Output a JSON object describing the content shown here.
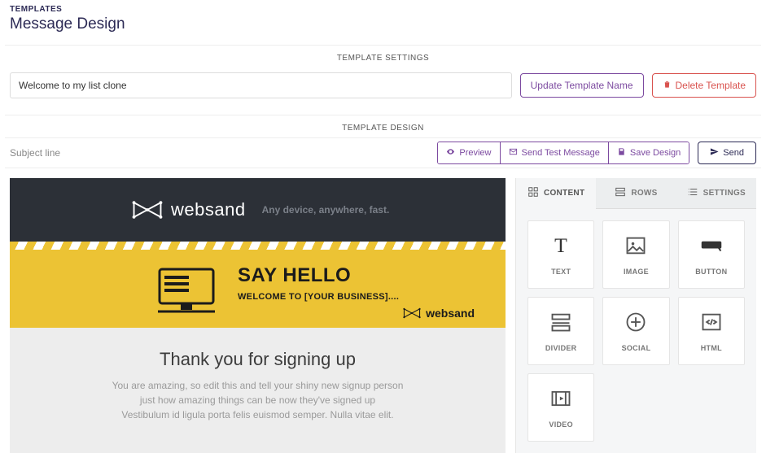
{
  "header": {
    "breadcrumb": "TEMPLATES",
    "title": "Message Design"
  },
  "sections": {
    "settings_label": "TEMPLATE SETTINGS",
    "design_label": "TEMPLATE DESIGN"
  },
  "template": {
    "name_value": "Welcome to my list clone",
    "update_btn": "Update Template Name",
    "delete_btn": "Delete Template"
  },
  "subject": {
    "placeholder": "Subject line",
    "value": ""
  },
  "actions": {
    "preview": "Preview",
    "send_test": "Send Test Message",
    "save_design": "Save Design",
    "send": "Send"
  },
  "email_preview": {
    "brand": "websand",
    "hero_tagline": "Any device, anywhere, fast.",
    "headline": "SAY HELLO",
    "subheadline": "WELCOME TO [YOUR BUSINESS]....",
    "footer_brand": "websand",
    "thanks_title": "Thank you for signing up",
    "thanks_body_1": "You are amazing, so edit this and tell your shiny new signup person",
    "thanks_body_2": "just how amazing things can be now they've signed up",
    "thanks_body_3": "Vestibulum id ligula porta felis euismod semper. Nulla vitae elit."
  },
  "sidepanel": {
    "tabs": {
      "content": "CONTENT",
      "rows": "ROWS",
      "settings": "SETTINGS"
    },
    "tiles": [
      "TEXT",
      "IMAGE",
      "BUTTON",
      "DIVIDER",
      "SOCIAL",
      "HTML",
      "VIDEO"
    ]
  }
}
